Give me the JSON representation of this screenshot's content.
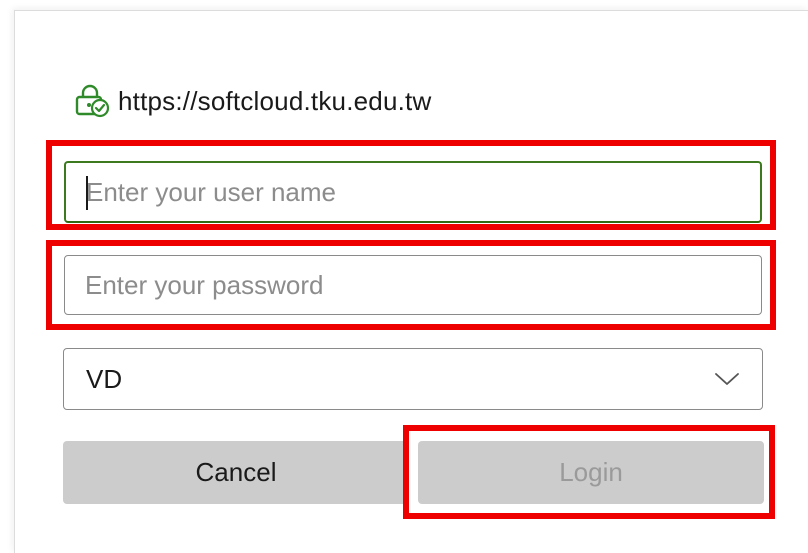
{
  "header": {
    "url": "https://softcloud.tku.edu.tw",
    "lock_icon": "lock-check-icon"
  },
  "form": {
    "username_placeholder": "Enter your user name",
    "username_value": "",
    "password_placeholder": "Enter your password",
    "password_value": "",
    "select_value": "VD",
    "select_icon": "chevron-down-icon"
  },
  "buttons": {
    "cancel_label": "Cancel",
    "login_label": "Login"
  },
  "colors": {
    "accent_green": "#3d7a1f",
    "highlight_red": "#ee0000",
    "button_bg": "#cccccc",
    "disabled_text": "#9a9a9a"
  }
}
